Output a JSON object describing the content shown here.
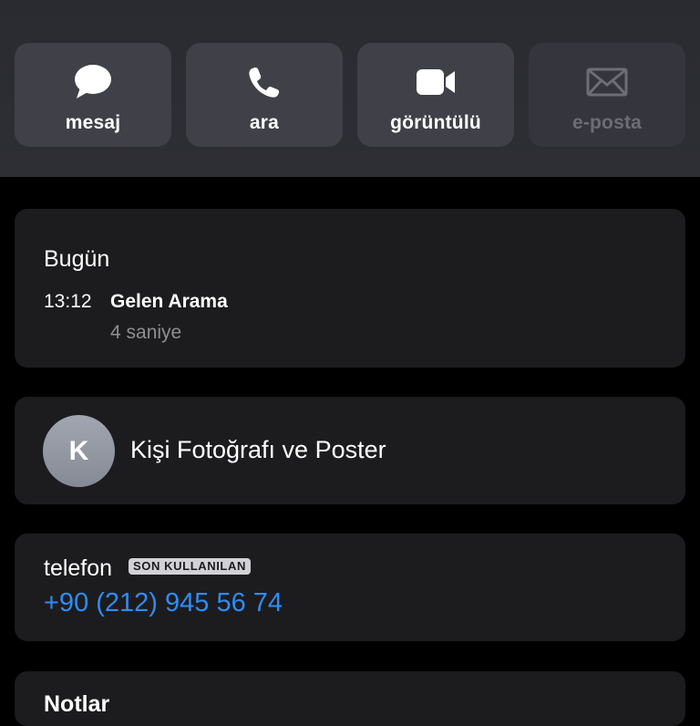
{
  "actions": [
    {
      "label": "mesaj",
      "icon": "message-bubble-icon"
    },
    {
      "label": "ara",
      "icon": "phone-icon"
    },
    {
      "label": "görüntülü",
      "icon": "video-camera-icon"
    },
    {
      "label": "e-posta",
      "icon": "envelope-icon",
      "disabled": true
    }
  ],
  "recents": {
    "day": "Bugün",
    "time": "13:12",
    "call_type": "Gelen Arama",
    "duration": "4 saniye"
  },
  "contact_photo": {
    "initial": "K",
    "label": "Kişi Fotoğrafı ve Poster"
  },
  "phone": {
    "label": "telefon",
    "badge": "SON KULLANILAN",
    "number": "+90 (212) 945 56 74"
  },
  "notes": {
    "label": "Notlar"
  },
  "colors": {
    "accent": "#2f8cf5",
    "card_bg": "#1c1c1e",
    "header_bg": "#2a2b30",
    "button_bg": "#3f4048"
  }
}
